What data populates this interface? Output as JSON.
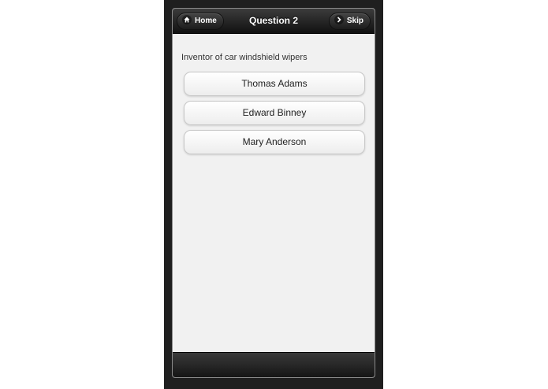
{
  "header": {
    "title": "Question 2",
    "home_label": "Home",
    "skip_label": "Skip"
  },
  "question": {
    "text": "Inventor of car windshield wipers"
  },
  "answers": [
    {
      "label": "Thomas Adams"
    },
    {
      "label": "Edward Binney"
    },
    {
      "label": "Mary Anderson"
    }
  ],
  "icons": {
    "home": "home-icon",
    "skip": "chevron-right-icon"
  }
}
